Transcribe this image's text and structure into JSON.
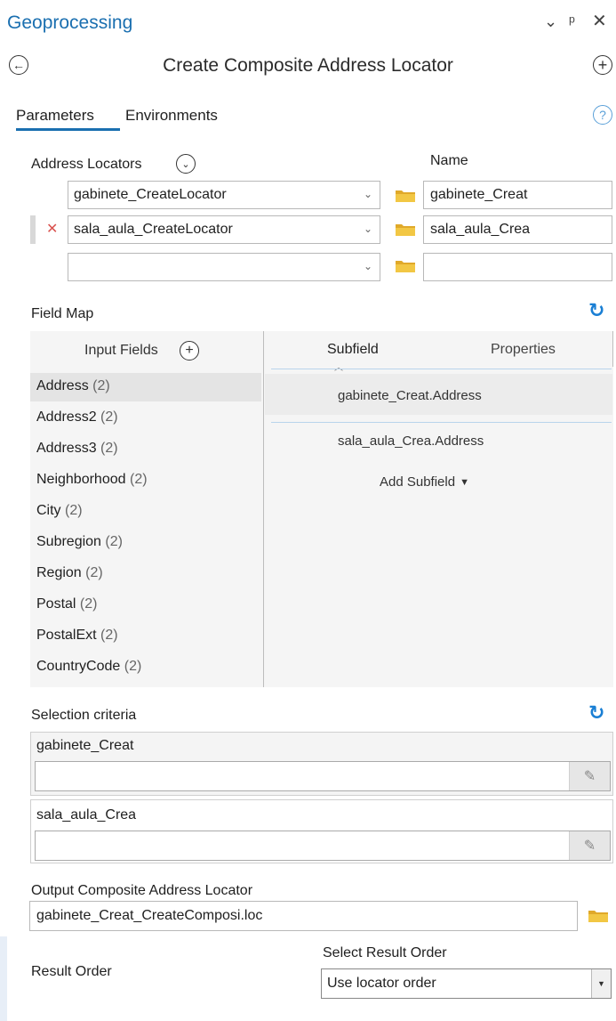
{
  "pane": {
    "title": "Geoprocessing",
    "tool_title": "Create Composite Address Locator"
  },
  "tabs": [
    {
      "label": "Parameters",
      "active": true
    },
    {
      "label": "Environments",
      "active": false
    }
  ],
  "address_locators": {
    "label": "Address Locators",
    "name_header": "Name",
    "rows": [
      {
        "locator": "gabinete_CreateLocator",
        "name": "gabinete_Creat"
      },
      {
        "locator": "sala_aula_CreateLocator",
        "name": "sala_aula_Crea"
      },
      {
        "locator": "",
        "name": ""
      }
    ]
  },
  "field_map": {
    "label": "Field Map",
    "input_fields_header": "Input Fields",
    "subfield_header": "Subfield",
    "properties_header": "Properties",
    "fields": [
      {
        "name": "Address",
        "count": "(2)"
      },
      {
        "name": "Address2",
        "count": "(2)"
      },
      {
        "name": "Address3",
        "count": "(2)"
      },
      {
        "name": "Neighborhood",
        "count": "(2)"
      },
      {
        "name": "City",
        "count": "(2)"
      },
      {
        "name": "Subregion",
        "count": "(2)"
      },
      {
        "name": "Region",
        "count": "(2)"
      },
      {
        "name": "Postal",
        "count": "(2)"
      },
      {
        "name": "PostalExt",
        "count": "(2)"
      },
      {
        "name": "CountryCode",
        "count": "(2)"
      }
    ],
    "subfields": [
      "gabinete_Creat.Address",
      "sala_aula_Crea.Address"
    ],
    "add_subfield_label": "Add Subfield"
  },
  "selection_criteria": {
    "label": "Selection criteria",
    "items": [
      {
        "name": "gabinete_Creat",
        "value": ""
      },
      {
        "name": "sala_aula_Crea",
        "value": ""
      }
    ]
  },
  "output": {
    "label": "Output Composite Address Locator",
    "value": "gabinete_Creat_CreateComposi.loc"
  },
  "result_order": {
    "label": "Result Order",
    "select_label": "Select Result Order",
    "selected": "Use locator order"
  },
  "colors": {
    "accent": "#1a6fb0",
    "folder": "#f2c744",
    "remove_x": "#d9534f"
  }
}
